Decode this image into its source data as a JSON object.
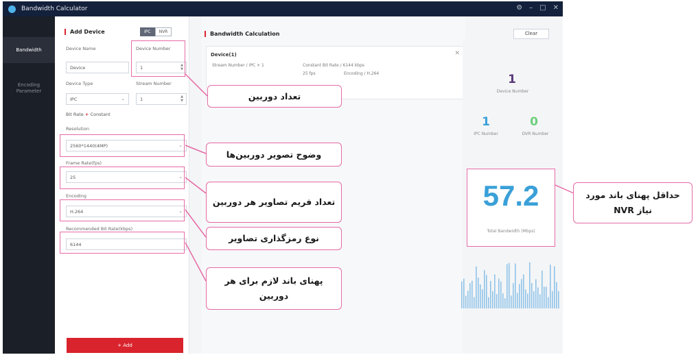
{
  "window": {
    "title": "Bandwidth Calculator",
    "controls": [
      "⚙",
      "–",
      "□",
      "✕"
    ]
  },
  "sidebar": {
    "items": [
      {
        "label": "Bandwidth"
      },
      {
        "label": "Encoding Parameter"
      }
    ]
  },
  "form": {
    "section_title": "Add Device",
    "toggle": {
      "option_a": "IPC",
      "option_b": "NVR"
    },
    "device_name": {
      "label": "Device Name",
      "value": "Device"
    },
    "device_number": {
      "label": "Device Number",
      "value": "1"
    },
    "device_type": {
      "label": "Device Type",
      "value": "IPC"
    },
    "stream_number": {
      "label": "Stream Number",
      "value": "1"
    },
    "bitrate_line": {
      "label": "Bit Rate",
      "value": "Constant"
    },
    "resolution": {
      "label": "Resolution",
      "value": "2560*1440(4MP)"
    },
    "frame_rate": {
      "label": "Frame Rate(fps)",
      "value": "25"
    },
    "encoding": {
      "label": "Encoding",
      "value": "H.264"
    },
    "recommended": {
      "label": "Recommended Bit Rate(kbps)",
      "value": "6144"
    },
    "add_button": "+ Add"
  },
  "calc": {
    "section_title": "Bandwidth Calculation",
    "clear_button": "Clear",
    "device": {
      "name": "Device(1)",
      "stream_number": "Stream Number / IPC × 1",
      "constant_bitrate": "Constant Bit Rate / 6144 kbps",
      "fps": "25 fps",
      "encoding": "Encoding / H.264"
    }
  },
  "stats": {
    "device_number_value": "1",
    "device_number_label": "Device Number",
    "ipc_number_value": "1",
    "ipc_number_label": "IPC Number",
    "dvr_number_value": "0",
    "dvr_number_label": "DVR Number",
    "total_bandwidth_value": "57.2",
    "total_bandwidth_label": "Total Bandwidth (Mbps)"
  },
  "callouts": {
    "device_count": "تعداد دوربین",
    "resolution": "وضوح تصویر دوربین‌ها",
    "frame_rate": "تعداد فریم تصاویر هر دوربین",
    "encoding": "نوع رمزگذاری تصاویر",
    "bandwidth_per_camera": "پهنای باند لازم برای هر دوربین",
    "min_nvr_bandwidth": "حداقل پهنای باند مورد نیاز NVR"
  },
  "colors": {
    "titlebar": "#14213c",
    "sidebar": "#1b1f27",
    "accent_red": "#d9232d",
    "stat_blue": "#3aa0d8",
    "stat_purple": "#5a3a7a",
    "callout_border": "#e56aa5"
  }
}
